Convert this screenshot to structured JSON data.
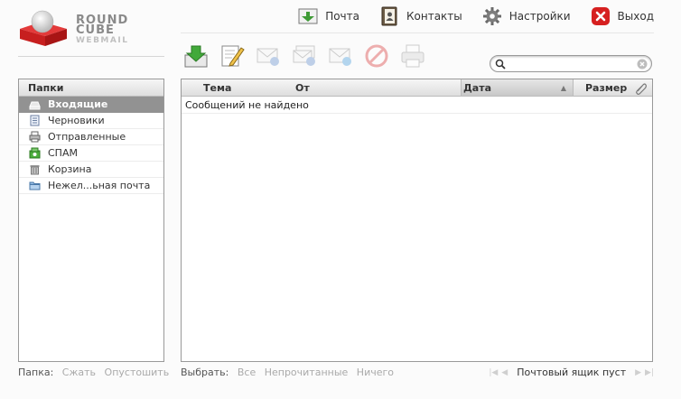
{
  "logo": {
    "line1": "ROUND",
    "line2": "CUBE",
    "line3": "WEBMAIL"
  },
  "topnav": [
    {
      "label": "Почта"
    },
    {
      "label": "Контакты"
    },
    {
      "label": "Настройки"
    },
    {
      "label": "Выход"
    }
  ],
  "toolbar": [
    {
      "icon": "check-mail-icon",
      "enabled": true
    },
    {
      "icon": "compose-icon",
      "enabled": true
    },
    {
      "icon": "reply-icon",
      "enabled": false
    },
    {
      "icon": "reply-all-icon",
      "enabled": false
    },
    {
      "icon": "forward-icon",
      "enabled": false
    },
    {
      "icon": "delete-icon",
      "enabled": false
    },
    {
      "icon": "print-icon",
      "enabled": false
    }
  ],
  "search": {
    "value": ""
  },
  "folders": {
    "header": "Папки",
    "items": [
      {
        "label": "Входящие",
        "icon": "inbox-icon",
        "selected": true
      },
      {
        "label": "Черновики",
        "icon": "drafts-icon",
        "selected": false
      },
      {
        "label": "Отправленные",
        "icon": "sent-icon",
        "selected": false
      },
      {
        "label": "СПАМ",
        "icon": "spam-icon",
        "selected": false
      },
      {
        "label": "Корзина",
        "icon": "trash-icon",
        "selected": false
      },
      {
        "label": "Нежел...ьная почта",
        "icon": "folder-icon",
        "selected": false
      }
    ]
  },
  "messages": {
    "columns": {
      "subject": "Тема",
      "from": "От",
      "date": "Дата",
      "size": "Размер"
    },
    "empty": "Сообщений не найдено"
  },
  "footer": {
    "folder_label": "Папка:",
    "compact": "Сжать",
    "empty": "Опустошить",
    "select_label": "Выбрать:",
    "select_all": "Все",
    "select_unread": "Непрочитанные",
    "select_none": "Ничего",
    "pager_text": "Почтовый ящик пуст"
  },
  "colors": {
    "selected_row": "#929292",
    "brand_red": "#d42b2b"
  }
}
